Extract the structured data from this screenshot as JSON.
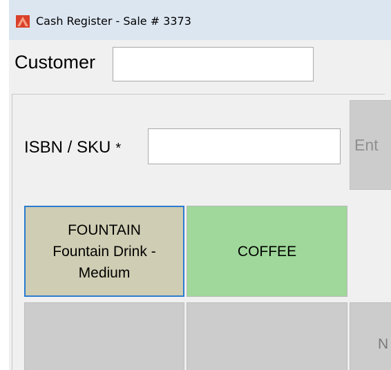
{
  "window": {
    "title": "Cash Register - Sale # 3373",
    "icon": "app-logo-icon",
    "titlebar_color": "#dce6f1"
  },
  "customer": {
    "label": "Customer",
    "value": ""
  },
  "lookup": {
    "label": "ISBN / SKU",
    "required_marker": "*",
    "value": "",
    "enter_button_label": "Ent"
  },
  "products": [
    {
      "code": "FOUNTAIN",
      "name_line1": "Fountain Drink -",
      "name_line2": "Medium",
      "color": "#cfcdb3",
      "selected": true
    },
    {
      "label": "COFFEE",
      "color": "#9fd89a",
      "selected": false
    },
    {
      "label": ""
    },
    {
      "label": ""
    },
    {
      "label": "N"
    }
  ],
  "colors": {
    "selection_border": "#2a7bd1",
    "empty_button": "#cccccc",
    "window_background": "#f0f0f0"
  }
}
